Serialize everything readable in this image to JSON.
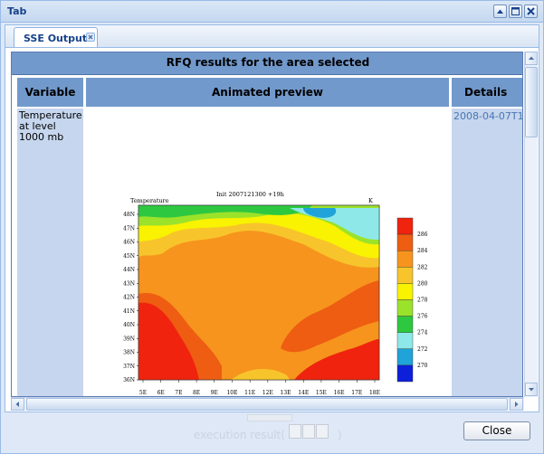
{
  "window": {
    "title": "Tab"
  },
  "tabs": [
    {
      "label": "SSE Output"
    }
  ],
  "results": {
    "caption": "RFQ results for the area selected",
    "columns": [
      "Variable",
      "Animated preview",
      "Details"
    ],
    "row": {
      "variable_lines": [
        "Temperature",
        "at level",
        "1000 mb"
      ],
      "details": "2008-04-07T1"
    }
  },
  "map": {
    "header_left": "Temperature",
    "header_center": "Init 2007121300   +19h",
    "header_right": "K",
    "lat_labels": [
      "48N",
      "47N",
      "46N",
      "45N",
      "44N",
      "43N",
      "42N",
      "41N",
      "40N",
      "39N",
      "38N",
      "37N",
      "36N"
    ],
    "lon_labels": [
      "5E",
      "6E",
      "7E",
      "8E",
      "9E",
      "10E",
      "11E",
      "12E",
      "13E",
      "14E",
      "15E",
      "16E",
      "17E",
      "18E"
    ],
    "legend_values": [
      "286",
      "284",
      "282",
      "280",
      "278",
      "276",
      "274",
      "272",
      "270"
    ],
    "legend_colors": [
      "#f0230e",
      "#ee5d12",
      "#f7941d",
      "#f7c52b",
      "#f9f200",
      "#9be22b",
      "#2ec840",
      "#8fe8e8",
      "#1fa3d9",
      "#0d1fd9"
    ]
  },
  "footer": {
    "execution_label": "execution result(",
    "execution_tail": ")",
    "close_label": "Close"
  }
}
